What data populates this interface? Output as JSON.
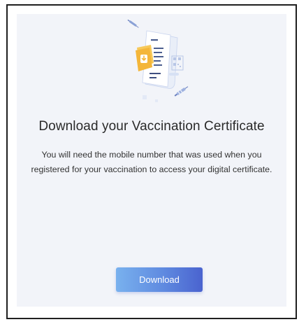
{
  "card": {
    "title": "Download your Vaccination Certificate",
    "description": "You will need the mobile number that was used when you registered for your vaccination to access your digital certificate.",
    "download_label": "Download"
  },
  "icons": {
    "illustration": "certificate-download-illustration",
    "syringe": "syringe-icon",
    "document": "document-icon",
    "qr": "qr-code-icon",
    "download_arrow": "download-arrow-icon"
  },
  "colors": {
    "card_background": "#f2f4f9",
    "button_gradient_start": "#79b1ee",
    "button_gradient_end": "#4a63cf",
    "folder_yellow": "#f4b63a",
    "text_dark": "#2a2a2a"
  }
}
